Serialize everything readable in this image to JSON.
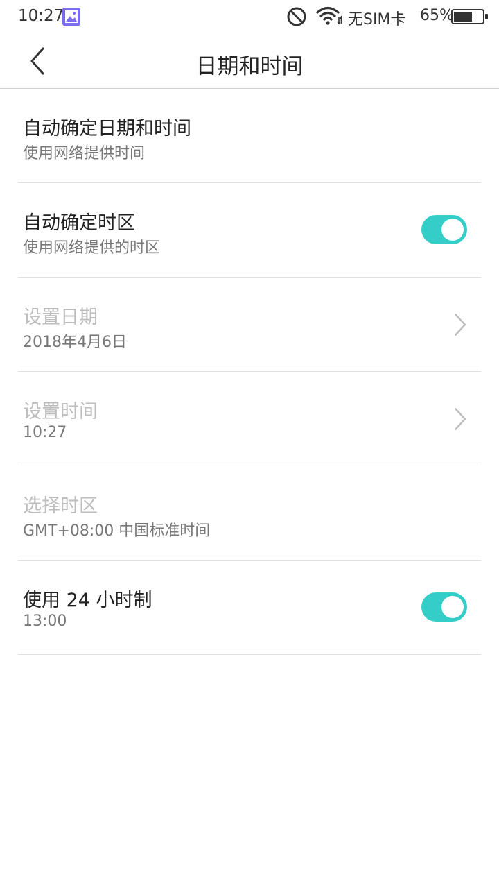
{
  "status_bar": {
    "time": "10:27",
    "sim": "无SIM卡",
    "battery": "65%",
    "battery_level": 0.65,
    "icons": [
      "gallery-icon",
      "do-not-disturb-icon",
      "wifi-icon",
      "battery-icon"
    ]
  },
  "header": {
    "title": "日期和时间",
    "back_icon": "back-arrow-icon"
  },
  "colors": {
    "accent": "#35cdc8",
    "disabled_text": "#bdbdbd",
    "subtitle": "#777777"
  },
  "settings": [
    {
      "title": "自动确定日期和时间",
      "subtitle": "使用网络提供时间",
      "control": "none",
      "enabled": true
    },
    {
      "title": "自动确定时区",
      "subtitle": "使用网络提供的时区",
      "control": "toggle",
      "on": true,
      "enabled": true
    },
    {
      "title": "设置日期",
      "subtitle": "2018年4月6日",
      "control": "chevron",
      "enabled": false
    },
    {
      "title": "设置时间",
      "subtitle": "10:27",
      "control": "chevron",
      "enabled": false
    },
    {
      "title": "选择时区",
      "subtitle": "GMT+08:00 中国标准时间",
      "control": "none",
      "enabled": false
    },
    {
      "title": "使用 24 小时制",
      "subtitle": "13:00",
      "control": "toggle",
      "on": true,
      "enabled": true
    }
  ]
}
